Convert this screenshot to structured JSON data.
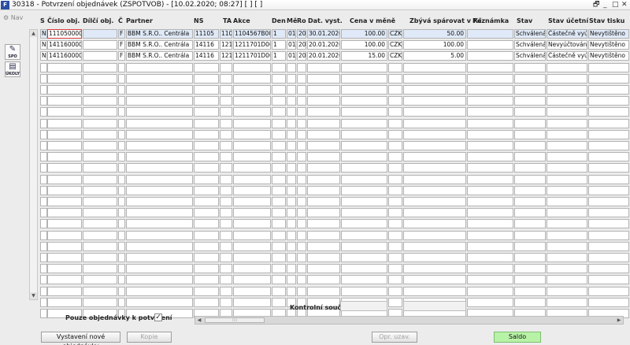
{
  "window": {
    "title": "30318 - Potvrzení objednávek (ZSPOTVOB) - [10.02.2020; 08:27]  [ ]  [ ]",
    "app_icon": "F",
    "controls": {
      "restore": "🗗",
      "minimize": "_",
      "maximize": "□",
      "close": "✕"
    }
  },
  "left": {
    "nav_label": "Nav",
    "tools": [
      {
        "label": "SPO",
        "icon": "tool-icon"
      },
      {
        "label": "ÚKOLY",
        "icon": "tasks-icon"
      }
    ]
  },
  "grid": {
    "headers": {
      "s": "S",
      "cislo": "Číslo obj.",
      "dilci": "Dílčí obj.",
      "c": "Č",
      "partner": "Partner",
      "ns": "NS",
      "ta": "TA",
      "akce": "Akce",
      "den": "Den",
      "me": "Mě",
      "ro": "Ro",
      "dat_vyst": "Dat. vyst.",
      "cena": "Cena v měně",
      "zbyva": "Zbývá spárovat v Kč",
      "poznamka": "Poznámka",
      "stav": "Stav",
      "stav_ucetni": "Stav účetní",
      "stav_tisku": "Stav tisku"
    },
    "rows": [
      {
        "s": "N",
        "cislo": "1110500008",
        "dilci": "",
        "c": "F",
        "partner": "BBM S.R.O.. Centrála",
        "ns": "11105",
        "ta": "110",
        "akce": "1104567B001",
        "den": "1",
        "me": "01",
        "ro": "20",
        "dat_vyst": "30.01.2020",
        "cena": "100.00",
        "mena": "CZK",
        "zbyva": "50.00",
        "poznamka": "",
        "stav": "Schválená",
        "stav_ucetni": "Částečně vyúčt",
        "stav_tisku": "Nevytištěno"
      },
      {
        "s": "N",
        "cislo": "1411600007",
        "dilci": "",
        "c": "F",
        "partner": "BBM S.R.O.. Centrála",
        "ns": "14116",
        "ta": "121",
        "akce": "1211701D000",
        "den": "1",
        "me": "01",
        "ro": "20",
        "dat_vyst": "20.01.2020",
        "cena": "100.00",
        "mena": "CZK",
        "zbyva": "100.00",
        "poznamka": "",
        "stav": "Schválená",
        "stav_ucetni": "Nevyúčtováno",
        "stav_tisku": "Nevytištěno"
      },
      {
        "s": "N",
        "cislo": "1411600006",
        "dilci": "",
        "c": "F",
        "partner": "BBM S.R.O.. Centrála",
        "ns": "14116",
        "ta": "121",
        "akce": "1211701D000",
        "den": "1",
        "me": "01",
        "ro": "20",
        "dat_vyst": "20.01.2020",
        "cena": "15.00",
        "mena": "CZK",
        "zbyva": "5.00",
        "poznamka": "",
        "stav": "Schválená",
        "stav_ucetni": "Částečně vyúčt",
        "stav_tisku": "Nevytištěno"
      }
    ],
    "empty_rows": 23
  },
  "footer": {
    "kontrolni_soucty": "Kontrolní součty",
    "filter_label": "Pouze objednávky k potvrzení",
    "filter_checked": "✓",
    "buttons": {
      "new_order": "Vystavení nové objednávky",
      "copy": "Kopie",
      "opr_uzav": "Opr. uzav.",
      "saldo": "Saldo"
    }
  }
}
